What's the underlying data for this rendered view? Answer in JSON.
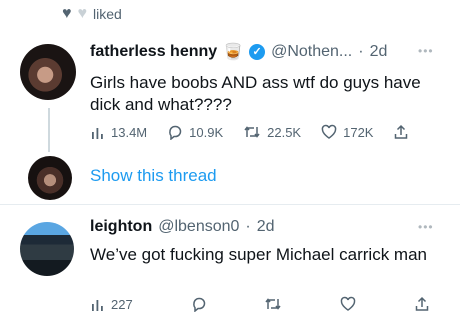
{
  "social_context": {
    "label": "liked"
  },
  "tweet": {
    "name": "fatherless henny",
    "name_emoji": "🥃",
    "handle": "@Nothen...",
    "separator": "·",
    "time": "2d",
    "text": "Girls have boobs AND ass wtf do guys have dick and what????",
    "metrics": {
      "views": "13.4M",
      "replies": "10.9K",
      "retweets": "22.5K",
      "likes": "172K"
    }
  },
  "show_thread": "Show this thread",
  "reply": {
    "name": "leighton",
    "handle": "@lbenson0",
    "separator": "·",
    "time": "2d",
    "text": "We’ve got fucking super Michael carrick man",
    "metrics": {
      "views": "227"
    }
  },
  "colors": {
    "accent": "#1d9bf0",
    "muted": "#536471",
    "divider": "#e6ecf0"
  }
}
